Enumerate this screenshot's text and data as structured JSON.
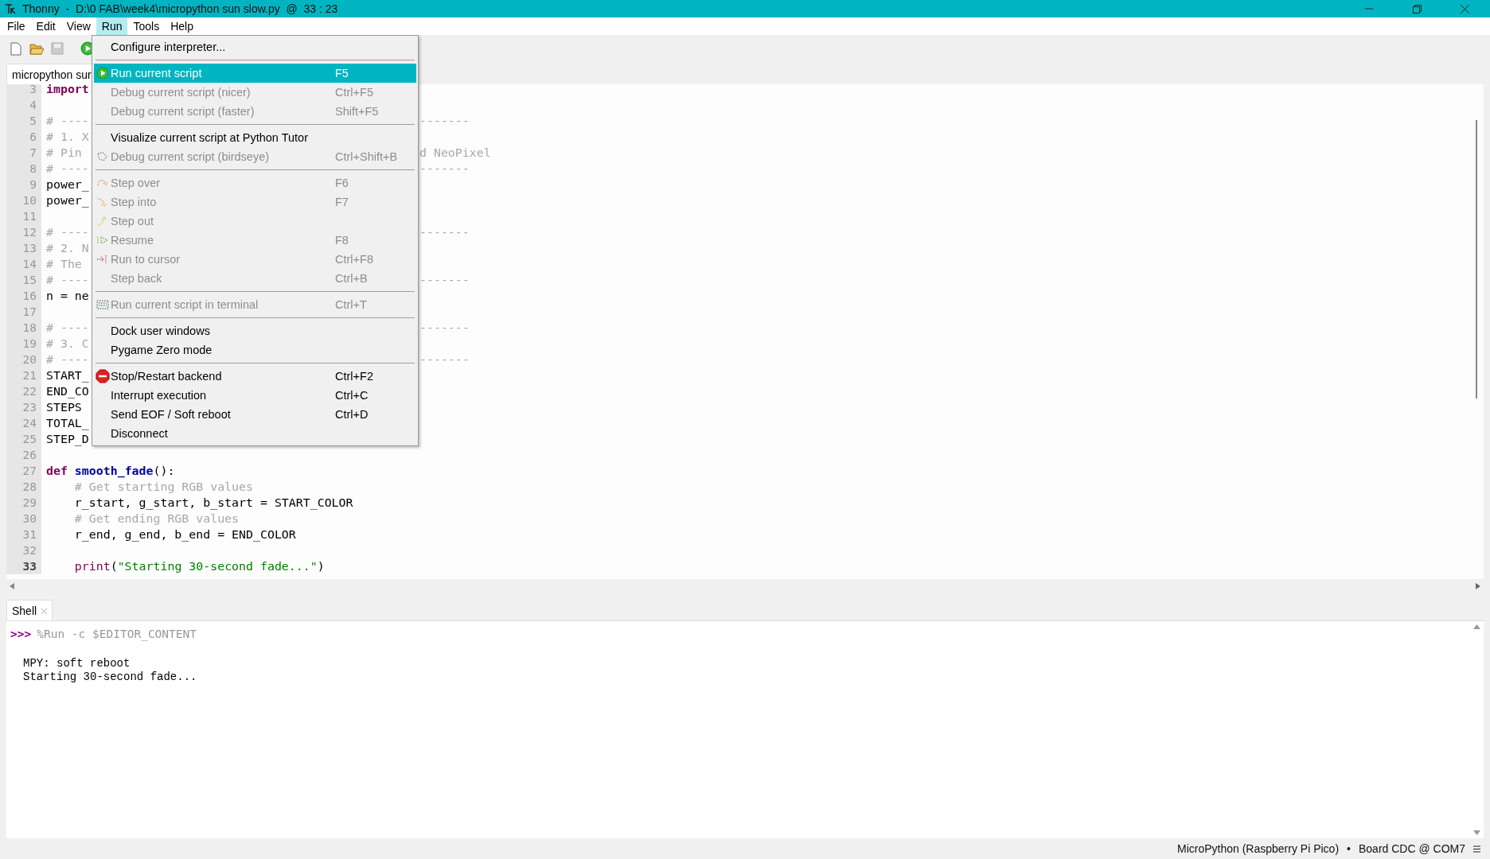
{
  "window": {
    "title": "Thonny  -  D:\\0 FAB\\week4\\micropython sun slow.py  @  33 : 23"
  },
  "menubar": [
    {
      "label": "File",
      "selected": false
    },
    {
      "label": "Edit",
      "selected": false
    },
    {
      "label": "View",
      "selected": false
    },
    {
      "label": "Run",
      "selected": true
    },
    {
      "label": "Tools",
      "selected": false
    },
    {
      "label": "Help",
      "selected": false
    }
  ],
  "editor_tab": {
    "label": "micropython sur"
  },
  "code_lines": [
    {
      "number": "3",
      "current": false,
      "segments": [
        {
          "text": "import",
          "kind": "keyword"
        }
      ]
    },
    {
      "number": "4",
      "current": false
    },
    {
      "number": "5",
      "current": false,
      "segments": [
        {
          "text": "# ----",
          "kind": "comment"
        }
      ],
      "right": "-------"
    },
    {
      "number": "6",
      "current": false,
      "segments": [
        {
          "text": "# 1. X",
          "kind": "comment"
        }
      ]
    },
    {
      "number": "7",
      "current": false,
      "segments": [
        {
          "text": "# Pin",
          "kind": "comment"
        }
      ],
      "right": "d NeoPixel"
    },
    {
      "number": "8",
      "current": false,
      "segments": [
        {
          "text": "# ----",
          "kind": "comment"
        }
      ],
      "right": "-------"
    },
    {
      "number": "9",
      "current": false,
      "segments": [
        {
          "text": "power_",
          "kind": "plain"
        }
      ]
    },
    {
      "number": "10",
      "current": false,
      "segments": [
        {
          "text": "power_",
          "kind": "plain"
        }
      ]
    },
    {
      "number": "11",
      "current": false
    },
    {
      "number": "12",
      "current": false,
      "segments": [
        {
          "text": "# ----",
          "kind": "comment"
        }
      ],
      "right": "-------"
    },
    {
      "number": "13",
      "current": false,
      "segments": [
        {
          "text": "# 2. N",
          "kind": "comment"
        }
      ]
    },
    {
      "number": "14",
      "current": false,
      "segments": [
        {
          "text": "# The",
          "kind": "comment"
        }
      ]
    },
    {
      "number": "15",
      "current": false,
      "segments": [
        {
          "text": "# ----",
          "kind": "comment"
        }
      ],
      "right": "-------"
    },
    {
      "number": "16",
      "current": false,
      "segments": [
        {
          "text": "n = ne",
          "kind": "plain"
        }
      ]
    },
    {
      "number": "17",
      "current": false
    },
    {
      "number": "18",
      "current": false,
      "segments": [
        {
          "text": "# ----",
          "kind": "comment"
        }
      ],
      "right": "-------"
    },
    {
      "number": "19",
      "current": false,
      "segments": [
        {
          "text": "# 3. C",
          "kind": "comment"
        }
      ]
    },
    {
      "number": "20",
      "current": false,
      "segments": [
        {
          "text": "# ----",
          "kind": "comment"
        }
      ],
      "right": "-------"
    },
    {
      "number": "21",
      "current": false,
      "segments": [
        {
          "text": "START_",
          "kind": "plain"
        }
      ]
    },
    {
      "number": "22",
      "current": false,
      "segments": [
        {
          "text": "END_CO",
          "kind": "plain"
        }
      ]
    },
    {
      "number": "23",
      "current": false,
      "segments": [
        {
          "text": "STEPS",
          "kind": "plain"
        }
      ]
    },
    {
      "number": "24",
      "current": false,
      "segments": [
        {
          "text": "TOTAL_",
          "kind": "plain"
        }
      ]
    },
    {
      "number": "25",
      "current": false,
      "segments": [
        {
          "text": "STEP_D",
          "kind": "plain"
        }
      ]
    },
    {
      "number": "26",
      "current": false
    },
    {
      "number": "27",
      "current": false,
      "segments": [
        {
          "text": "def",
          "kind": "keyword"
        },
        {
          "text": " smooth_fade",
          "kind": "definition"
        },
        {
          "text": "():",
          "kind": "plain"
        }
      ]
    },
    {
      "number": "28",
      "current": false,
      "segments": [
        {
          "text": "    # Get starting RGB values",
          "kind": "comment"
        }
      ]
    },
    {
      "number": "29",
      "current": false,
      "segments": [
        {
          "text": "    r_start, g_start, b_start = START_COLOR",
          "kind": "plain"
        }
      ]
    },
    {
      "number": "30",
      "current": false,
      "segments": [
        {
          "text": "    # Get ending RGB values",
          "kind": "comment"
        }
      ]
    },
    {
      "number": "31",
      "current": false,
      "segments": [
        {
          "text": "    r_end, g_end, b_end = END_COLOR",
          "kind": "plain"
        }
      ]
    },
    {
      "number": "32",
      "current": false
    },
    {
      "number": "33",
      "current": true,
      "segments": [
        {
          "text": "    print",
          "kind": "builtin"
        },
        {
          "text": "(",
          "kind": "plain"
        },
        {
          "text": "\"Starting 30-second fade...\"",
          "kind": "string"
        },
        {
          "text": ")",
          "kind": "plain"
        }
      ]
    }
  ],
  "run_menu": {
    "groups": [
      [
        {
          "label": "Configure interpreter...",
          "disabled": false,
          "selected": false
        }
      ],
      [
        {
          "label": "Run current script",
          "shortcut": "F5",
          "disabled": false,
          "selected": true
        },
        {
          "label": "Debug current script (nicer)",
          "shortcut": "Ctrl+F5",
          "disabled": true,
          "selected": false
        },
        {
          "label": "Debug current script (faster)",
          "shortcut": "Shift+F5",
          "disabled": true,
          "selected": false
        }
      ],
      [
        {
          "label": "Visualize current script at Python Tutor",
          "disabled": false,
          "selected": false
        },
        {
          "label": "Debug current script (birdseye)",
          "shortcut": "Ctrl+Shift+B",
          "disabled": true,
          "selected": false
        }
      ],
      [
        {
          "label": "Step over",
          "shortcut": "F6",
          "disabled": true,
          "selected": false
        },
        {
          "label": "Step into",
          "shortcut": "F7",
          "disabled": true,
          "selected": false
        },
        {
          "label": "Step out",
          "disabled": true,
          "selected": false
        },
        {
          "label": "Resume",
          "shortcut": "F8",
          "disabled": true,
          "selected": false
        },
        {
          "label": "Run to cursor",
          "shortcut": "Ctrl+F8",
          "disabled": true,
          "selected": false
        },
        {
          "label": "Step back",
          "shortcut": "Ctrl+B",
          "disabled": true,
          "selected": false
        }
      ],
      [
        {
          "label": "Run current script in terminal",
          "shortcut": "Ctrl+T",
          "disabled": true,
          "selected": false
        }
      ],
      [
        {
          "label": "Dock user windows",
          "disabled": false,
          "selected": false
        },
        {
          "label": "Pygame Zero mode",
          "disabled": false,
          "selected": false
        }
      ],
      [
        {
          "label": "Stop/Restart backend",
          "shortcut": "Ctrl+F2",
          "disabled": false,
          "selected": false
        },
        {
          "label": "Interrupt execution",
          "shortcut": "Ctrl+C",
          "disabled": false,
          "selected": false
        },
        {
          "label": "Send EOF / Soft reboot",
          "shortcut": "Ctrl+D",
          "disabled": false,
          "selected": false
        },
        {
          "label": "Disconnect",
          "disabled": false,
          "selected": false
        }
      ]
    ]
  },
  "shell": {
    "tab": "Shell",
    "prompt": ">>>",
    "command": "%Run -c $EDITOR_CONTENT",
    "output": [
      "MPY: soft reboot",
      "Starting 30-second fade..."
    ]
  },
  "status_bar": {
    "interpreter": "MicroPython (Raspberry Pi Pico)",
    "separator": "•",
    "port": "Board CDC @ COM7"
  }
}
